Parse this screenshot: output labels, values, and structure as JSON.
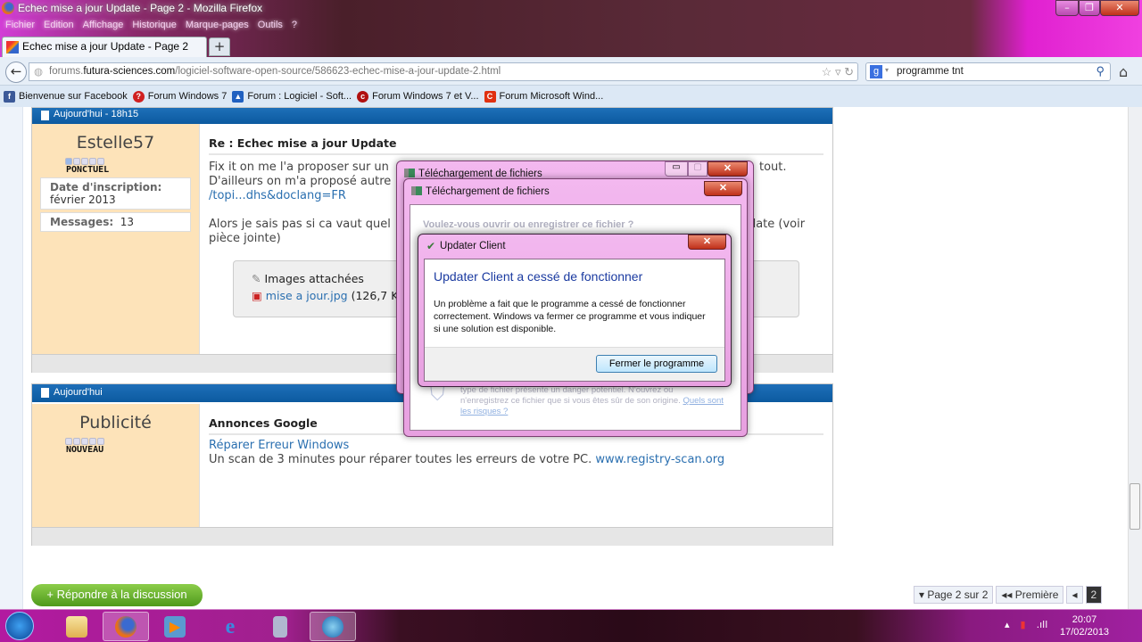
{
  "window": {
    "title": "Echec mise a jour Update - Page 2 - Mozilla Firefox",
    "controls": [
      "–",
      "❐",
      "✕"
    ]
  },
  "menu": [
    "Fichier",
    "Edition",
    "Affichage",
    "Historique",
    "Marque-pages",
    "Outils",
    "?"
  ],
  "tab": {
    "label": "Echec mise a jour Update - Page 2",
    "new_tab": "+"
  },
  "nav": {
    "url_host_prefix": "forums.",
    "url_host": "futura-sciences.com",
    "url_path": "/logiciel-software-open-source/586623-echec-mise-a-jour-update-2.html",
    "search_value": "programme tnt"
  },
  "bookmarks": [
    {
      "label": "Bienvenue sur Facebook",
      "color": "#3b5998",
      "glyph": "f"
    },
    {
      "label": "Forum Windows 7",
      "color": "#d02020",
      "glyph": "?"
    },
    {
      "label": "Forum : Logiciel - Soft...",
      "color": "#2060c0",
      "glyph": "▲"
    },
    {
      "label": "Forum Windows 7 et V...",
      "color": "#b01010",
      "glyph": "c"
    },
    {
      "label": "Forum Microsoft Wind...",
      "color": "#e03010",
      "glyph": "C"
    }
  ],
  "post1": {
    "date": "Aujourd'hui - 18h15",
    "user": "Estelle57",
    "rank": "PONCTUEL",
    "rank_level": 1,
    "join_label": "Date d'inscription:",
    "join_value": "février 2013",
    "messages_label": "Messages:",
    "messages_value": "13",
    "title": "Re : Echec mise a jour Update",
    "line1": "Fix it on me l'a proposer sur un",
    "line1_end": "tout.",
    "line2": "D'ailleurs on m'a proposé autre",
    "link": "/topi...dhs&doclang=FR",
    "line3": "Alors je sais pas si ca vaut quel",
    "line3_end": "odate (voir",
    "line4": "pièce jointe)",
    "attach_title": "Images attachées",
    "attach_file": "mise a jour.jpg",
    "attach_size": "(126,7 K"
  },
  "post2": {
    "date": "Aujourd'hui",
    "user": "Publicité",
    "rank": "NOUVEAU",
    "rank_level": 0,
    "title": "Annonces Google",
    "ad_link": "Réparer Erreur Windows",
    "ad_text": "Un scan de 3 minutes pour réparer toutes les erreurs de votre PC.",
    "ad_url": "www.registry-scan.org"
  },
  "reply_button": "+ Répondre à la discussion",
  "pager": {
    "page": "▾ Page 2 sur 2",
    "first": "◂◂ Première",
    "prev": "◂",
    "current": "2"
  },
  "dialogs": {
    "download_back_title": "Téléchargement de fichiers",
    "download_title": "Téléchargement de fichiers",
    "download_question": "Voulez-vous ouvrir ou enregistrer ce fichier ?",
    "download_warn1": "type de fichier présente un danger potentiel. N'ouvrez ou",
    "download_warn2": "n'enregistrez ce fichier que si vous êtes sûr de son origine.",
    "download_risk_link": "Quels sont les risques ?",
    "crash_title": "Updater Client",
    "crash_heading": "Updater Client a cessé de fonctionner",
    "crash_body": "Un problème a fait que le programme a cessé de fonctionner correctement. Windows va fermer ce programme et vous indiquer si une solution est disponible.",
    "crash_button": "Fermer le programme"
  },
  "taskbar": {
    "time": "20:07",
    "date": "17/02/2013",
    "apps": [
      "explorer",
      "firefox",
      "media-player",
      "internet-explorer",
      "app",
      "network-app"
    ]
  }
}
